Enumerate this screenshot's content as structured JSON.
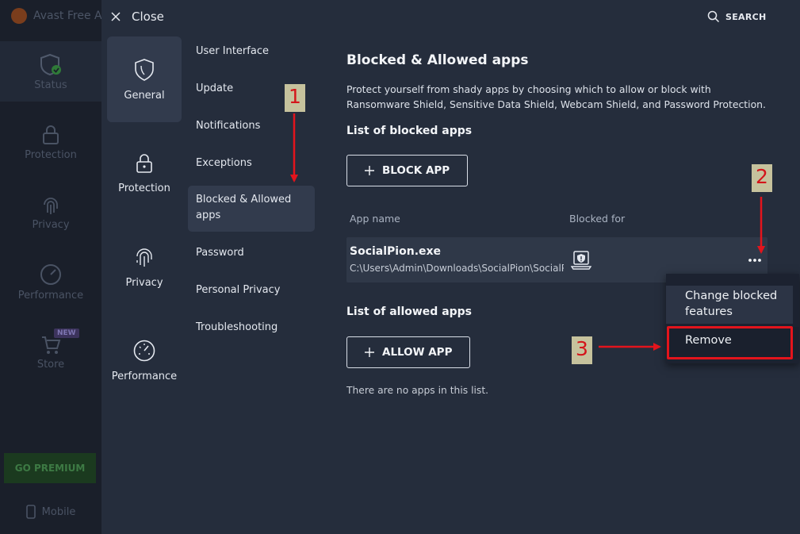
{
  "background_app": {
    "title": "Avast Free A",
    "nav": [
      {
        "label": "Status"
      },
      {
        "label": "Protection"
      },
      {
        "label": "Privacy"
      },
      {
        "label": "Performance"
      },
      {
        "label": "Store",
        "badge": "NEW"
      }
    ],
    "premium_label": "GO PREMIUM",
    "mobile_label": "Mobile"
  },
  "settings": {
    "close_label": "Close",
    "search_label": "SEARCH",
    "categories": [
      {
        "label": "General",
        "icon": "shield-icon",
        "active": true
      },
      {
        "label": "Protection",
        "icon": "lock-icon"
      },
      {
        "label": "Privacy",
        "icon": "fingerprint-icon"
      },
      {
        "label": "Performance",
        "icon": "speedometer-icon"
      }
    ],
    "subcategories": [
      {
        "label": "User Interface"
      },
      {
        "label": "Update"
      },
      {
        "label": "Notifications"
      },
      {
        "label": "Exceptions"
      },
      {
        "label": "Blocked & Allowed apps",
        "active": true
      },
      {
        "label": "Password"
      },
      {
        "label": "Personal Privacy"
      },
      {
        "label": "Troubleshooting"
      }
    ]
  },
  "content": {
    "title": "Blocked & Allowed apps",
    "description": "Protect yourself from shady apps by choosing which to allow or block with Ransomware Shield, Sensitive Data Shield, Webcam Shield, and Password Protection.",
    "blocked_heading": "List of blocked apps",
    "block_button": "BLOCK APP",
    "columns": {
      "app_name": "App name",
      "blocked_for": "Blocked for"
    },
    "blocked_apps": [
      {
        "name": "SocialPion.exe",
        "path": "C:\\Users\\Admin\\Downloads\\SocialPion\\SocialPion.exe",
        "blocked_for_icon": "laptop-shield-icon"
      }
    ],
    "allowed_heading": "List of allowed apps",
    "allow_button": "ALLOW APP",
    "allowed_empty": "There are no apps in this list."
  },
  "context_menu": {
    "items": [
      {
        "label": "Change blocked features"
      },
      {
        "label": "Remove"
      }
    ]
  },
  "annotations": {
    "steps": [
      "1",
      "2",
      "3"
    ],
    "color": "#e3141c"
  },
  "colors": {
    "overlay_bg": "#252d3c",
    "active_item_bg": "#323b4d",
    "row_bg": "#2f3848",
    "menu_bg": "#1c2230"
  }
}
